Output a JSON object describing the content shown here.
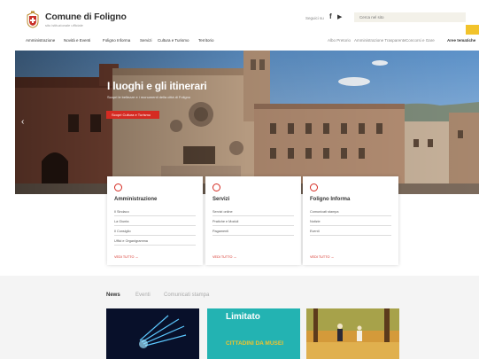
{
  "header": {
    "title": "Comune di Foligno",
    "subtitle": "sito istituzionale ufficiale",
    "follow_label": "Seguici su",
    "social": [
      "f",
      "▶"
    ],
    "search_placeholder": "Cerca nel sito"
  },
  "nav": {
    "left": [
      "Amministrazione",
      "Novità e Eventi",
      "Foligno Informa",
      "Servizi",
      "Cultura e Turismo",
      "Territorio"
    ],
    "right": [
      "Albo Pretorio",
      "Amministrazione Trasparente",
      "Concorsi e Gare",
      "Aree tematiche"
    ]
  },
  "hero": {
    "title": "I luoghi e gli itinerari",
    "subtitle": "Scopri le bellezze e i monumenti della città di Foligno",
    "button": "Scopri Cultura e Turismo"
  },
  "cards": [
    {
      "title": "Amministrazione",
      "rows": [
        "Il Sindaco",
        "La Giunta",
        "Il Consiglio",
        "Uffici e Organigramma"
      ],
      "link": "VEDI TUTTO →"
    },
    {
      "title": "Servizi",
      "rows": [
        "Servizi online",
        "Pratiche e Moduli",
        "Pagamenti"
      ],
      "link": "VEDI TUTTO →"
    },
    {
      "title": "Foligno Informa",
      "rows": [
        "Comunicati stampa",
        "Notizie",
        "Eventi"
      ],
      "link": "VEDI TUTTO →"
    }
  ],
  "tabs": [
    "News",
    "Eventi",
    "Comunicati stampa"
  ],
  "thumbs": {
    "center_title": "Limitato",
    "center_caption": "CITTADINI DA MUSEI"
  },
  "colors": {
    "accent_red": "#d52b22",
    "accent_yellow": "#f2c32b",
    "teal": "#23b3b2"
  }
}
